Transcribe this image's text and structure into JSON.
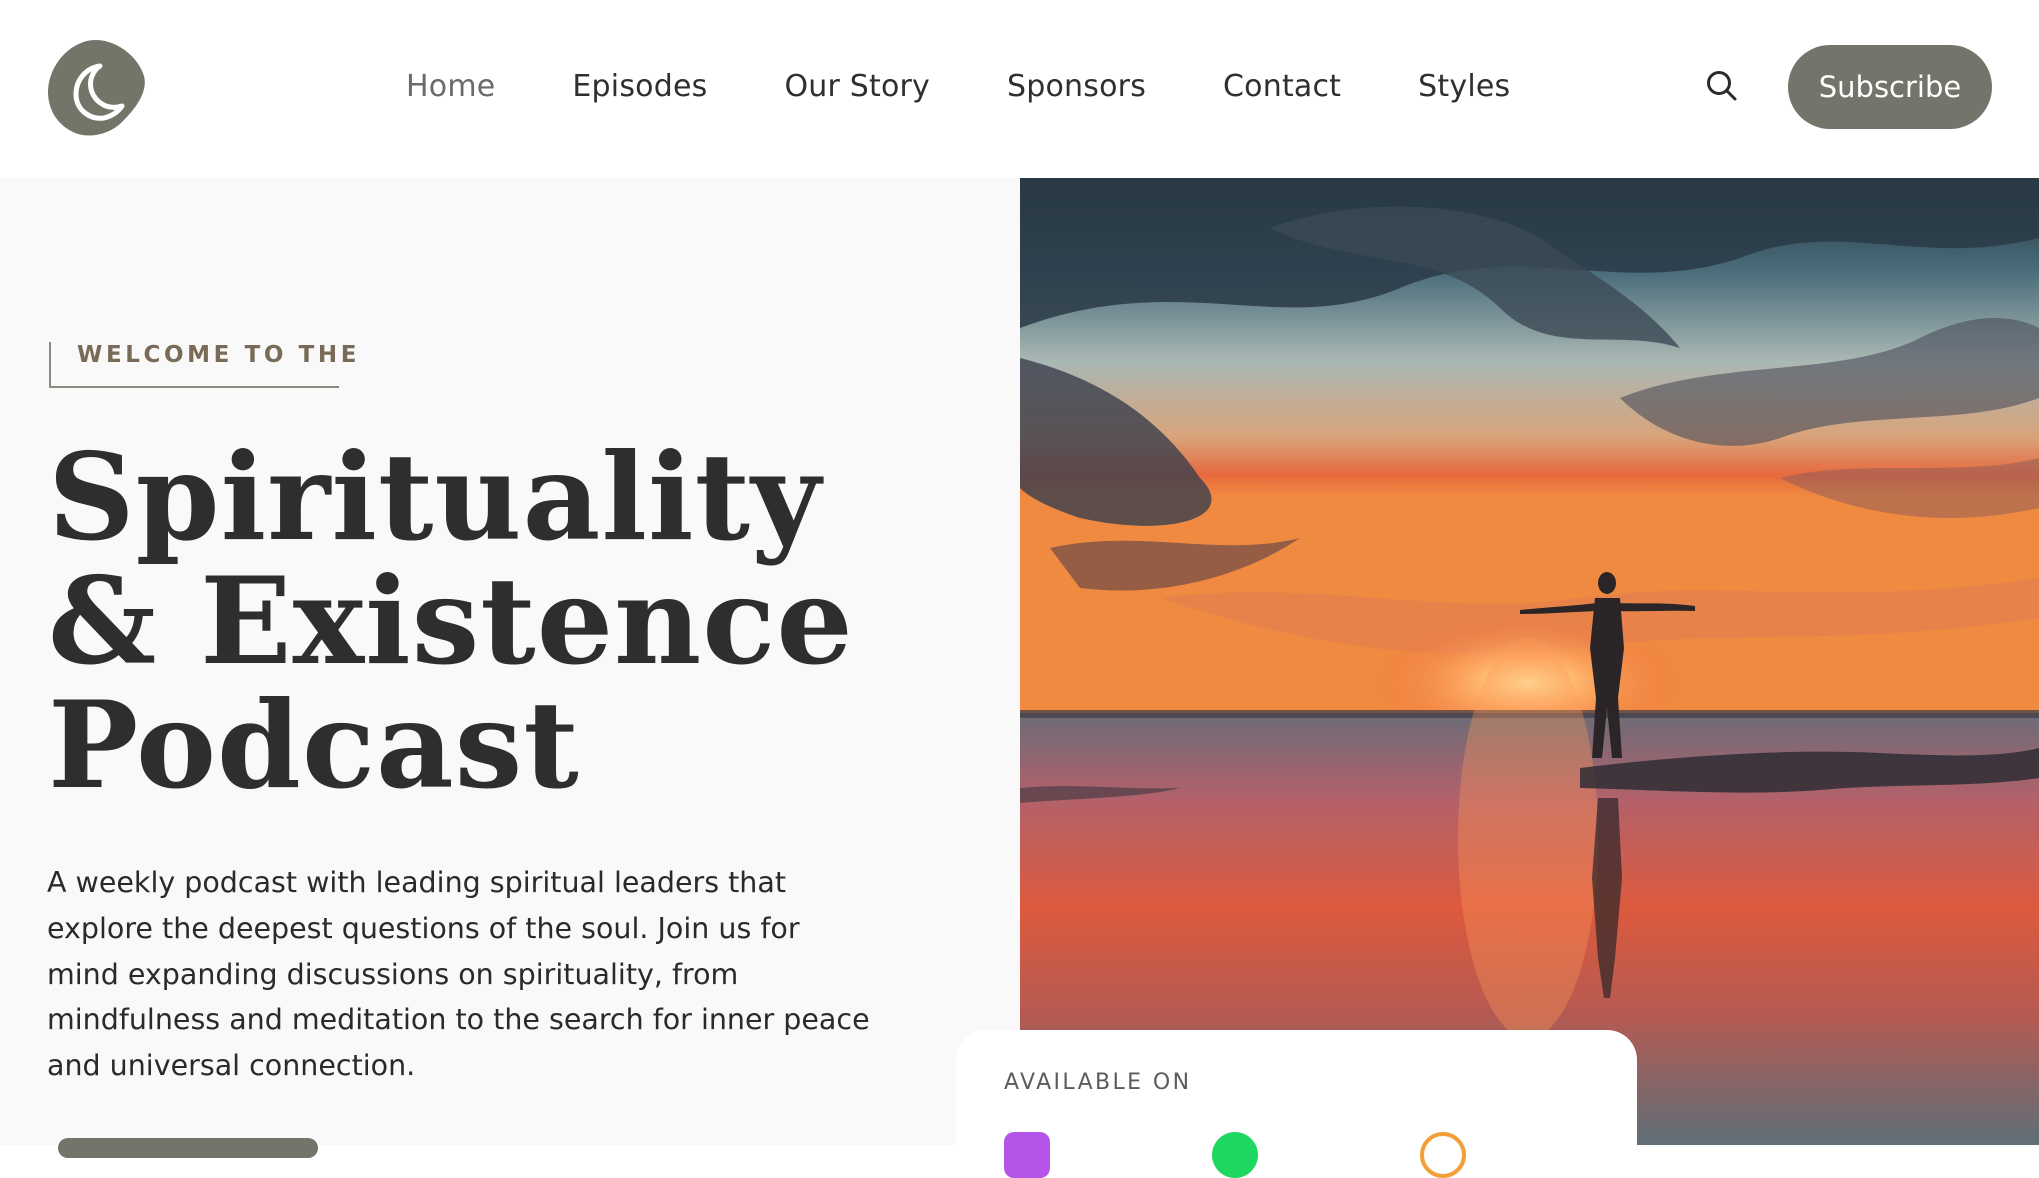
{
  "header": {
    "logo_icon": "moon-icon",
    "nav": [
      {
        "label": "Home",
        "active": true
      },
      {
        "label": "Episodes"
      },
      {
        "label": "Our Story"
      },
      {
        "label": "Sponsors"
      },
      {
        "label": "Contact"
      },
      {
        "label": "Styles"
      }
    ],
    "search_icon": "search-icon",
    "subscribe_label": "Subscribe"
  },
  "hero": {
    "eyebrow": "WELCOME TO THE",
    "title_lines": [
      "Spirituality",
      "& Existence",
      "Podcast"
    ],
    "description": "A weekly podcast with leading spiritual leaders that explore the deepest questions of the soul. Join us for mind expanding discussions on spirituality, from mindfulness and meditation to the search for inner peace and universal connection.",
    "image_alt": "Silhouette of a person with outstretched arms at sunset on a beach"
  },
  "available": {
    "label": "AVAILABLE ON",
    "platforms": [
      {
        "icon": "apple-podcasts-icon",
        "color": "#b554e8"
      },
      {
        "icon": "spotify-icon",
        "color": "#1ed760"
      },
      {
        "icon": "google-podcasts-icon",
        "color": "#f29f3a"
      }
    ]
  },
  "colors": {
    "accent": "#72756a",
    "eyebrow": "#7a6a58",
    "text": "#2a2a2a"
  }
}
